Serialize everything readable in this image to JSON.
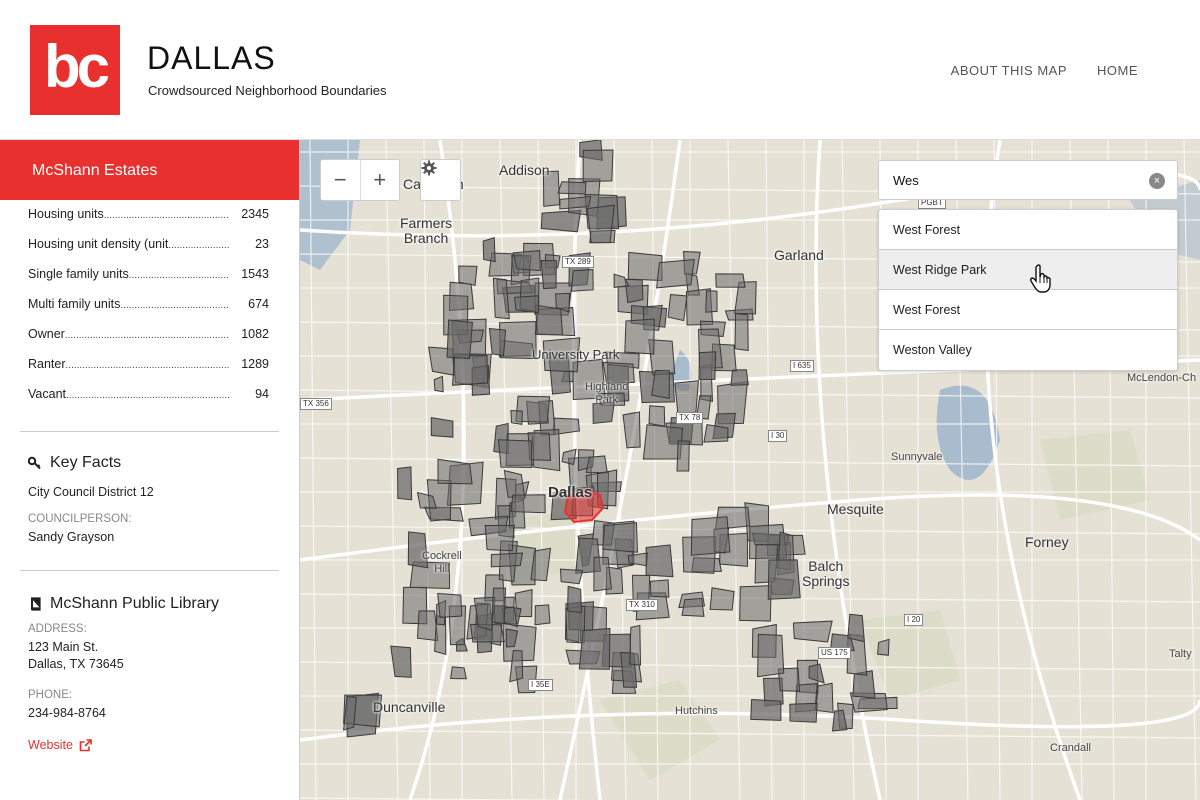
{
  "header": {
    "logo_text": "bc",
    "title": "DALLAS",
    "subtitle": "Crowdsourced Neighborhood Boundaries",
    "nav": [
      "ABOUT THIS MAP",
      "HOME"
    ],
    "brand_color": "#e8312e"
  },
  "sidebar": {
    "neighborhood": "McShann Estates",
    "stats": [
      {
        "label": "Housing units",
        "value": "2345"
      },
      {
        "label": "Housing unit density (unit",
        "value": "23"
      },
      {
        "label": "Single family units",
        "value": "1543"
      },
      {
        "label": "Multi family units",
        "value": "674"
      },
      {
        "label": "Owner",
        "value": "1082"
      },
      {
        "label": "Ranter",
        "value": "1289"
      },
      {
        "label": "Vacant",
        "value": "94"
      }
    ],
    "key_facts": {
      "title": "Key Facts",
      "icon": "key-icon",
      "district": "City Council District 12",
      "councilperson_label": "COUNCILPERSON:",
      "councilperson": "Sandy Grayson"
    },
    "library": {
      "title": "McShann Public Library",
      "icon": "book-icon",
      "address_label": "ADDRESS:",
      "address_line1": "123 Main St.",
      "address_line2": "Dallas, TX 73645",
      "phone_label": "PHONE:",
      "phone": "234-984-8764",
      "website_label": "Website"
    }
  },
  "map": {
    "controls": {
      "zoom_out": "−",
      "zoom_in": "+",
      "settings_icon": "gear-icon"
    },
    "search": {
      "value": "Wes",
      "clear_icon": "clear-circle-icon"
    },
    "suggestions": [
      "West Forest",
      "West Ridge Park",
      "West Forest",
      "Weston Valley"
    ],
    "hovered_suggestion": "West Ridge Park",
    "labels": {
      "addison": "Addison",
      "carrollton": "Carrollton",
      "farmers_branch": "Farmers\nBranch",
      "garland": "Garland",
      "university_park": "University Park",
      "highland_park": "Highland\nPark",
      "dallas": "Dallas",
      "mesquite": "Mesquite",
      "sunnyvale": "Sunnyvale",
      "forney": "Forney",
      "balch_springs": "Balch\nSprings",
      "cockrell_hill": "Cockrell\nHill",
      "duncanville": "Duncanville",
      "hutchins": "Hutchins",
      "talty": "Talty",
      "crandall": "Crandall",
      "mclendon": "McLendon-Ch"
    },
    "shields": [
      "TX 289",
      "I 635",
      "TX 356",
      "TX 78",
      "I 30",
      "TX 310",
      "I 20",
      "US 175",
      "I 35E",
      "PGBT"
    ],
    "selected_color": "#e8312e"
  }
}
